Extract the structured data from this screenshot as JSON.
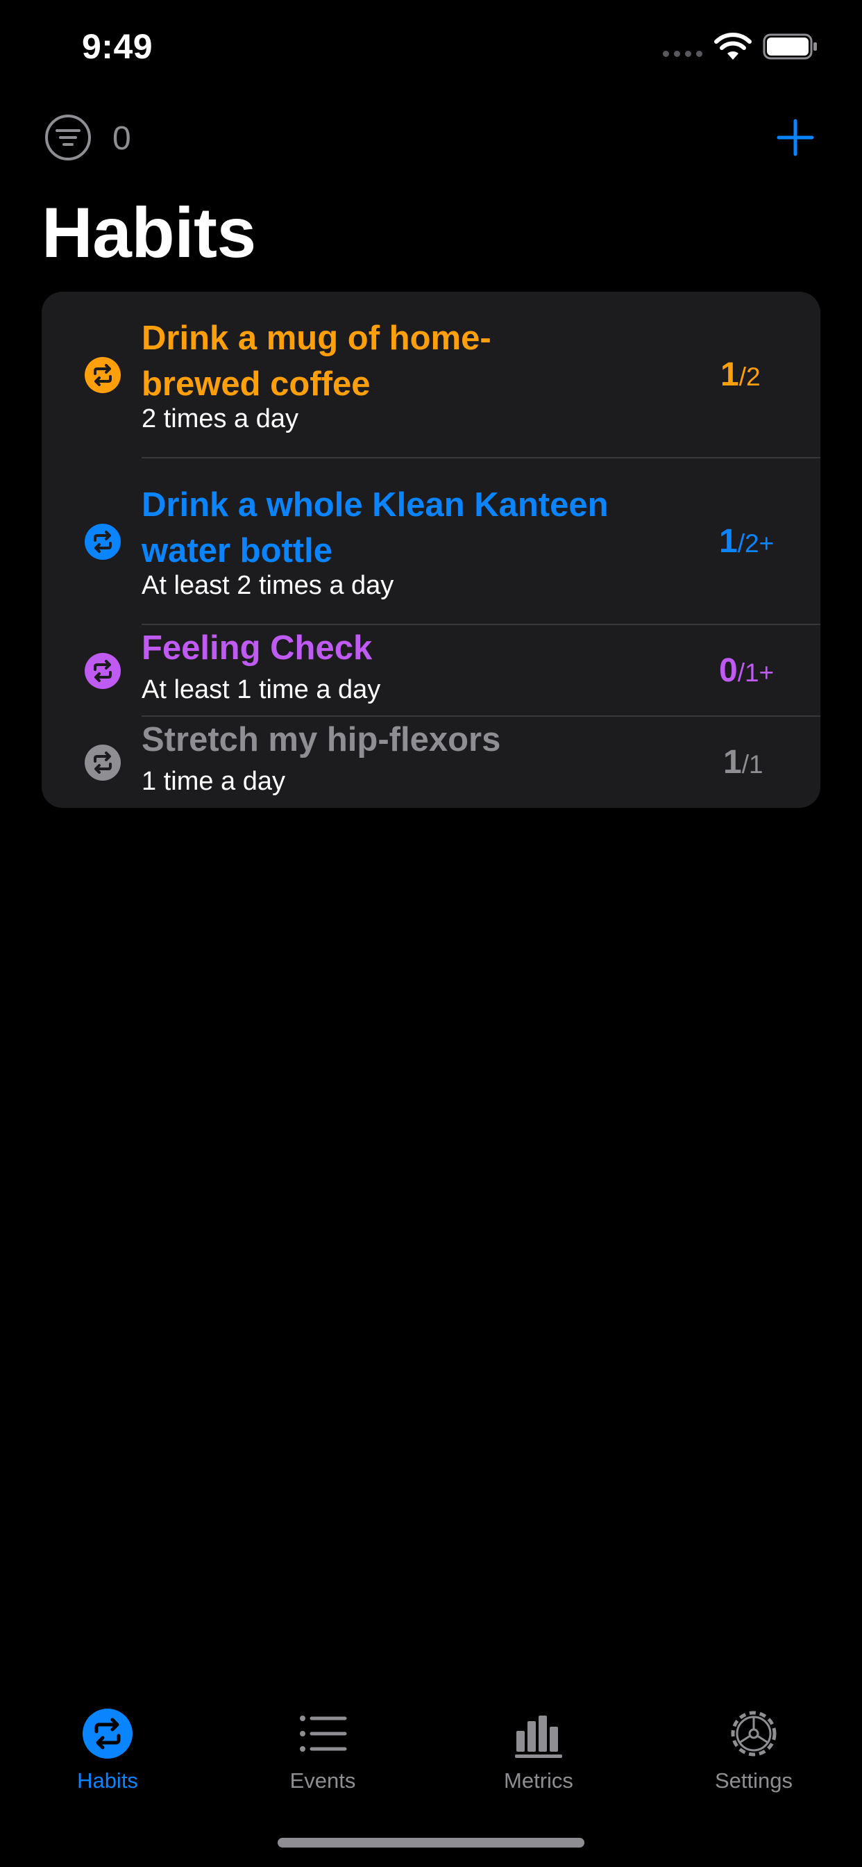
{
  "status_bar": {
    "time": "9:49"
  },
  "header": {
    "filter_icon": "filter-lines-icon",
    "filter_count": "0",
    "add_icon": "plus-icon",
    "title": "Habits"
  },
  "habits": [
    {
      "title_line1": "Drink a mug of home-",
      "title_line2": "brewed coffee",
      "frequency": "2 times a day",
      "done": "1",
      "target": "/2",
      "color": "#ff9f0a",
      "icon": "repeat-circle-icon"
    },
    {
      "title_line1": "Drink a whole Klean Kanteen",
      "title_line2": "water bottle",
      "frequency": "At least 2 times a day",
      "done": "1",
      "target": "/2+",
      "color": "#0a84ff",
      "icon": "repeat-circle-icon"
    },
    {
      "title_line1": "Feeling Check",
      "frequency": "At least 1 time a day",
      "done": "0",
      "target": "/1+",
      "color": "#bf5af2",
      "icon": "repeat-circle-icon"
    },
    {
      "title_line1": "Stretch my hip-flexors",
      "frequency": "1 time a day",
      "done": "1",
      "target": "/1",
      "color": "#8e8e93",
      "icon": "repeat-circle-icon"
    }
  ],
  "tab_bar": {
    "tabs": [
      {
        "label": "Habits",
        "icon": "repeat-circle-icon",
        "active": true
      },
      {
        "label": "Events",
        "icon": "list-icon",
        "active": false
      },
      {
        "label": "Metrics",
        "icon": "bar-chart-icon",
        "active": false
      },
      {
        "label": "Settings",
        "icon": "gear-icon",
        "active": false
      }
    ],
    "active_color": "#0a84ff",
    "inactive_color": "#8e8e93"
  }
}
